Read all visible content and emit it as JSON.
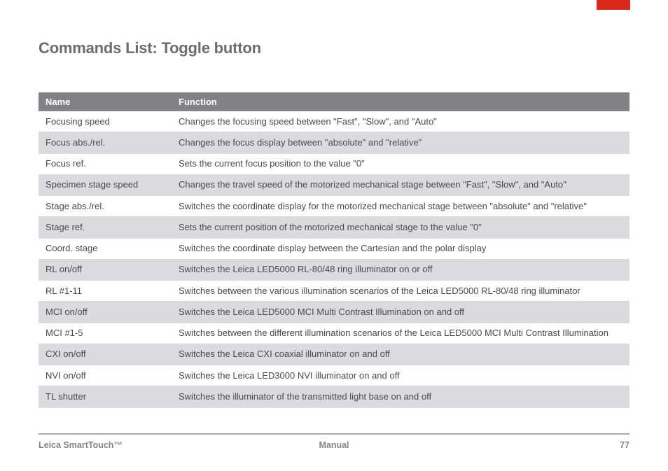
{
  "title": "Commands List: Toggle button",
  "table": {
    "headers": {
      "name": "Name",
      "function": "Function"
    },
    "rows": [
      {
        "name": "Focusing speed",
        "function": "Changes the focusing speed between \"Fast\", \"Slow\", and \"Auto\""
      },
      {
        "name": "Focus abs./rel.",
        "function": "Changes the focus display between \"absolute\" and \"relative\""
      },
      {
        "name": "Focus ref.",
        "function": "Sets the current focus position to the value \"0\""
      },
      {
        "name": "Specimen stage speed",
        "function": "Changes the travel speed of the motorized mechanical stage between \"Fast\", \"Slow\", and \"Auto\""
      },
      {
        "name": "Stage abs./rel.",
        "function": "Switches the coordinate display for the motorized mechanical stage between \"absolute\" and \"relative\""
      },
      {
        "name": "Stage ref.",
        "function": "Sets the current position of the motorized mechanical stage to the value \"0\""
      },
      {
        "name": "Coord. stage",
        "function": "Switches the coordinate display between the Cartesian and the polar display"
      },
      {
        "name": "RL on/off",
        "function": "Switches the Leica LED5000 RL-80/48 ring illuminator on or off"
      },
      {
        "name": "RL #1-11",
        "function": "Switches between the various illumination scenarios of the Leica LED5000 RL-80/48 ring illuminator"
      },
      {
        "name": "MCI on/off",
        "function": "Switches the Leica LED5000 MCI Multi Contrast Illumination on and off"
      },
      {
        "name": "MCI #1-5",
        "function": "Switches between the different illumination scenarios of the Leica LED5000 MCI Multi Contrast Illumination"
      },
      {
        "name": "CXI on/off",
        "function": "Switches the Leica CXI coaxial illuminator on and off"
      },
      {
        "name": "NVI on/off",
        "function": "Switches the Leica LED3000 NVI illuminator on and off"
      },
      {
        "name": "TL shutter",
        "function": "Switches the illuminator of the transmitted light base on and off"
      }
    ]
  },
  "footer": {
    "left": "Leica SmartTouch™",
    "center": "Manual",
    "right": "77"
  }
}
